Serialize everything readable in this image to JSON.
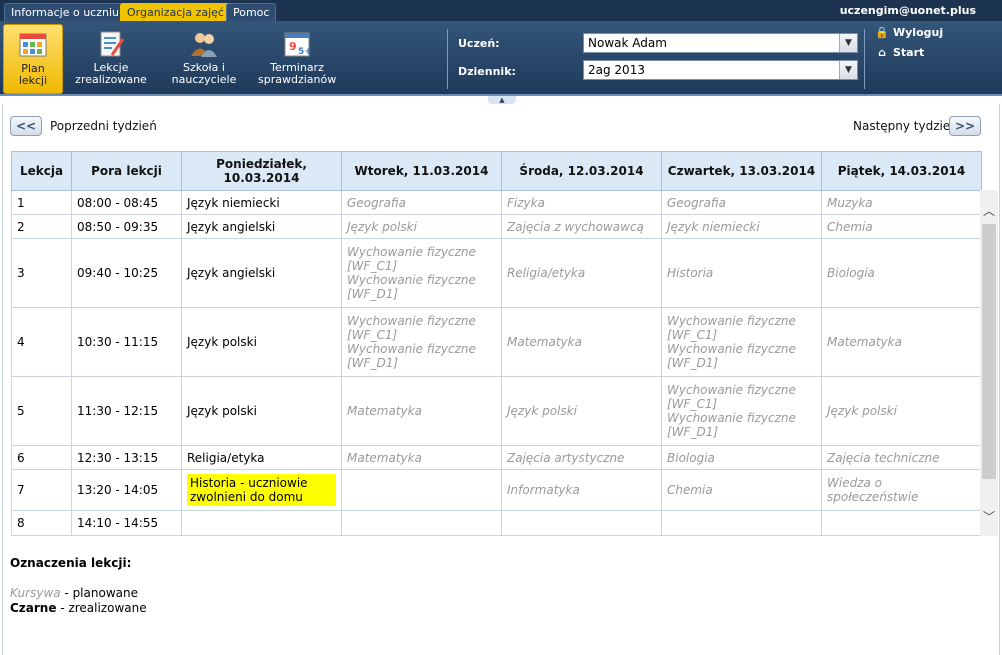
{
  "tabs": [
    {
      "label": "Informacje o uczniu",
      "active": false
    },
    {
      "label": "Organizacja zajęć",
      "active": true
    },
    {
      "label": "Pomoc",
      "active": false
    }
  ],
  "user_email": "uczengim@uonet.plus",
  "toolbar": {
    "items": [
      {
        "label_line1": "Plan",
        "label_line2": "lekcji",
        "icon": "calendar-grid-icon",
        "active": true
      },
      {
        "label_line1": "Lekcje",
        "label_line2": "zrealizowane",
        "icon": "checklist-pen-icon",
        "active": false
      },
      {
        "label_line1": "Szkoła i",
        "label_line2": "nauczyciele",
        "icon": "people-icon",
        "active": false
      },
      {
        "label_line1": "Terminarz",
        "label_line2": "sprawdzianów",
        "icon": "calendar-9-icon",
        "active": false
      }
    ],
    "student_label": "Uczeń:",
    "student_value": "Nowak Adam",
    "journal_label": "Dziennik:",
    "journal_value": "2ag 2013",
    "logout_label": "Wyloguj",
    "start_label": "Start",
    "logout_icon": "lock-icon",
    "start_icon": "home-icon"
  },
  "nav": {
    "prev_label": "Poprzedni tydzień",
    "next_label": "Następny tydzień",
    "prev_glyph": "<<",
    "next_glyph": ">>"
  },
  "table": {
    "headers": [
      "Lekcja",
      "Pora lekcji",
      "Poniedziałek, 10.03.2014",
      "Wtorek, 11.03.2014",
      "Środa, 12.03.2014",
      "Czwartek, 13.03.2014",
      "Piątek, 14.03.2014"
    ],
    "rows": [
      {
        "nr": "1",
        "time": "08:00 - 08:45",
        "height": 24,
        "days": [
          {
            "lines": [
              "Język niemiecki"
            ],
            "planned": false
          },
          {
            "lines": [
              "Geografia"
            ],
            "planned": true
          },
          {
            "lines": [
              "Fizyka"
            ],
            "planned": true
          },
          {
            "lines": [
              "Geografia"
            ],
            "planned": true
          },
          {
            "lines": [
              "Muzyka"
            ],
            "planned": true
          }
        ]
      },
      {
        "nr": "2",
        "time": "08:50 - 09:35",
        "height": 24,
        "days": [
          {
            "lines": [
              "Język angielski"
            ],
            "planned": false
          },
          {
            "lines": [
              "Język polski"
            ],
            "planned": true
          },
          {
            "lines": [
              "Zajęcia z wychowawcą"
            ],
            "planned": true
          },
          {
            "lines": [
              "Język niemiecki"
            ],
            "planned": true
          },
          {
            "lines": [
              "Chemia"
            ],
            "planned": true
          }
        ]
      },
      {
        "nr": "3",
        "time": "09:40 - 10:25",
        "height": 69,
        "days": [
          {
            "lines": [
              "Język angielski"
            ],
            "planned": false
          },
          {
            "lines": [
              "Wychowanie fizyczne",
              "[WF_C1]",
              "Wychowanie fizyczne",
              "[WF_D1]"
            ],
            "planned": true
          },
          {
            "lines": [
              "Religia/etyka"
            ],
            "planned": true
          },
          {
            "lines": [
              "Historia"
            ],
            "planned": true
          },
          {
            "lines": [
              "Biologia"
            ],
            "planned": true
          }
        ]
      },
      {
        "nr": "4",
        "time": "10:30 - 11:15",
        "height": 69,
        "days": [
          {
            "lines": [
              "Język polski"
            ],
            "planned": false
          },
          {
            "lines": [
              "Wychowanie fizyczne",
              "[WF_C1]",
              "Wychowanie fizyczne",
              "[WF_D1]"
            ],
            "planned": true
          },
          {
            "lines": [
              "Matematyka"
            ],
            "planned": true
          },
          {
            "lines": [
              "Wychowanie fizyczne",
              "[WF_C1]",
              "Wychowanie fizyczne",
              "[WF_D1]"
            ],
            "planned": true
          },
          {
            "lines": [
              "Matematyka"
            ],
            "planned": true
          }
        ]
      },
      {
        "nr": "5",
        "time": "11:30 - 12:15",
        "height": 69,
        "days": [
          {
            "lines": [
              "Język polski"
            ],
            "planned": false
          },
          {
            "lines": [
              "Matematyka"
            ],
            "planned": true
          },
          {
            "lines": [
              "Język polski"
            ],
            "planned": true
          },
          {
            "lines": [
              "Wychowanie fizyczne",
              "[WF_C1]",
              "Wychowanie fizyczne",
              "[WF_D1]"
            ],
            "planned": true
          },
          {
            "lines": [
              "Język polski"
            ],
            "planned": true
          }
        ]
      },
      {
        "nr": "6",
        "time": "12:30 - 13:15",
        "height": 24,
        "days": [
          {
            "lines": [
              "Religia/etyka"
            ],
            "planned": false
          },
          {
            "lines": [
              "Matematyka"
            ],
            "planned": true
          },
          {
            "lines": [
              "Zajęcia artystyczne"
            ],
            "planned": true
          },
          {
            "lines": [
              "Biologia"
            ],
            "planned": true
          },
          {
            "lines": [
              "Zajęcia techniczne"
            ],
            "planned": true
          }
        ]
      },
      {
        "nr": "7",
        "time": "13:20 - 14:05",
        "height": 41,
        "days": [
          {
            "lines": [
              "Historia - uczniowie",
              "zwolnieni do domu"
            ],
            "planned": false,
            "highlight": true
          },
          {
            "lines": [],
            "planned": true
          },
          {
            "lines": [
              "Informatyka"
            ],
            "planned": true
          },
          {
            "lines": [
              "Chemia"
            ],
            "planned": true
          },
          {
            "lines": [
              "Wiedza o społeczeństwie"
            ],
            "planned": true
          }
        ]
      },
      {
        "nr": "8",
        "time": "14:10 - 14:55",
        "height": 25,
        "days": [
          {
            "lines": [],
            "planned": false
          },
          {
            "lines": [],
            "planned": true
          },
          {
            "lines": [],
            "planned": true
          },
          {
            "lines": [],
            "planned": true
          },
          {
            "lines": [],
            "planned": true
          }
        ]
      }
    ]
  },
  "legend": {
    "title": "Oznaczenia lekcji:",
    "italic_word": "Kursywa",
    "italic_desc": " - planowane",
    "bold_word": "Czarne",
    "bold_desc": " - zrealizowane"
  },
  "colors": {
    "header_bg": "#1d3450",
    "active_tab": "#f2c300",
    "table_header": "#dbe9f6",
    "highlight": "#ffff00",
    "planned_text": "#9a9a9a"
  }
}
